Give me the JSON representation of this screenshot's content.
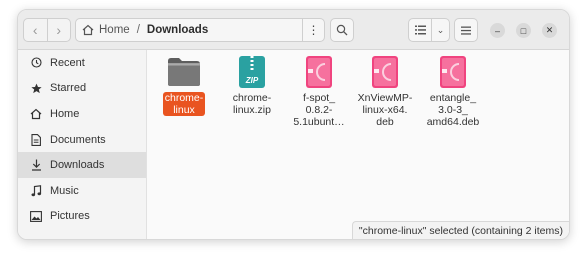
{
  "path": {
    "home": "Home",
    "separator": "/",
    "current": "Downloads"
  },
  "sidebar": {
    "items": [
      {
        "label": "Recent",
        "icon": "clock-icon"
      },
      {
        "label": "Starred",
        "icon": "star-icon"
      },
      {
        "label": "Home",
        "icon": "home-icon"
      },
      {
        "label": "Documents",
        "icon": "document-icon"
      },
      {
        "label": "Downloads",
        "icon": "download-icon",
        "active": true
      },
      {
        "label": "Music",
        "icon": "music-note-icon"
      },
      {
        "label": "Pictures",
        "icon": "picture-icon"
      }
    ]
  },
  "files": [
    {
      "name": "chrome-\nlinux",
      "type": "folder",
      "selected": true
    },
    {
      "name": "chrome-\nlinux.zip",
      "type": "zip",
      "badge": "ZIP"
    },
    {
      "name": "f-spot_\n0.8.2-\n5.1ubunt…",
      "type": "deb"
    },
    {
      "name": "XnViewMP-\nlinux-x64.\ndeb",
      "type": "deb"
    },
    {
      "name": "entangle_\n3.0-3_\namd64.deb",
      "type": "deb"
    }
  ],
  "status": "\"chrome-linux\" selected  (containing 2 items)",
  "colors": {
    "accent": "#e95420",
    "deb_pink": "#f0447f",
    "zip_teal": "#2aa1a1",
    "folder": "#6e6e6e"
  }
}
